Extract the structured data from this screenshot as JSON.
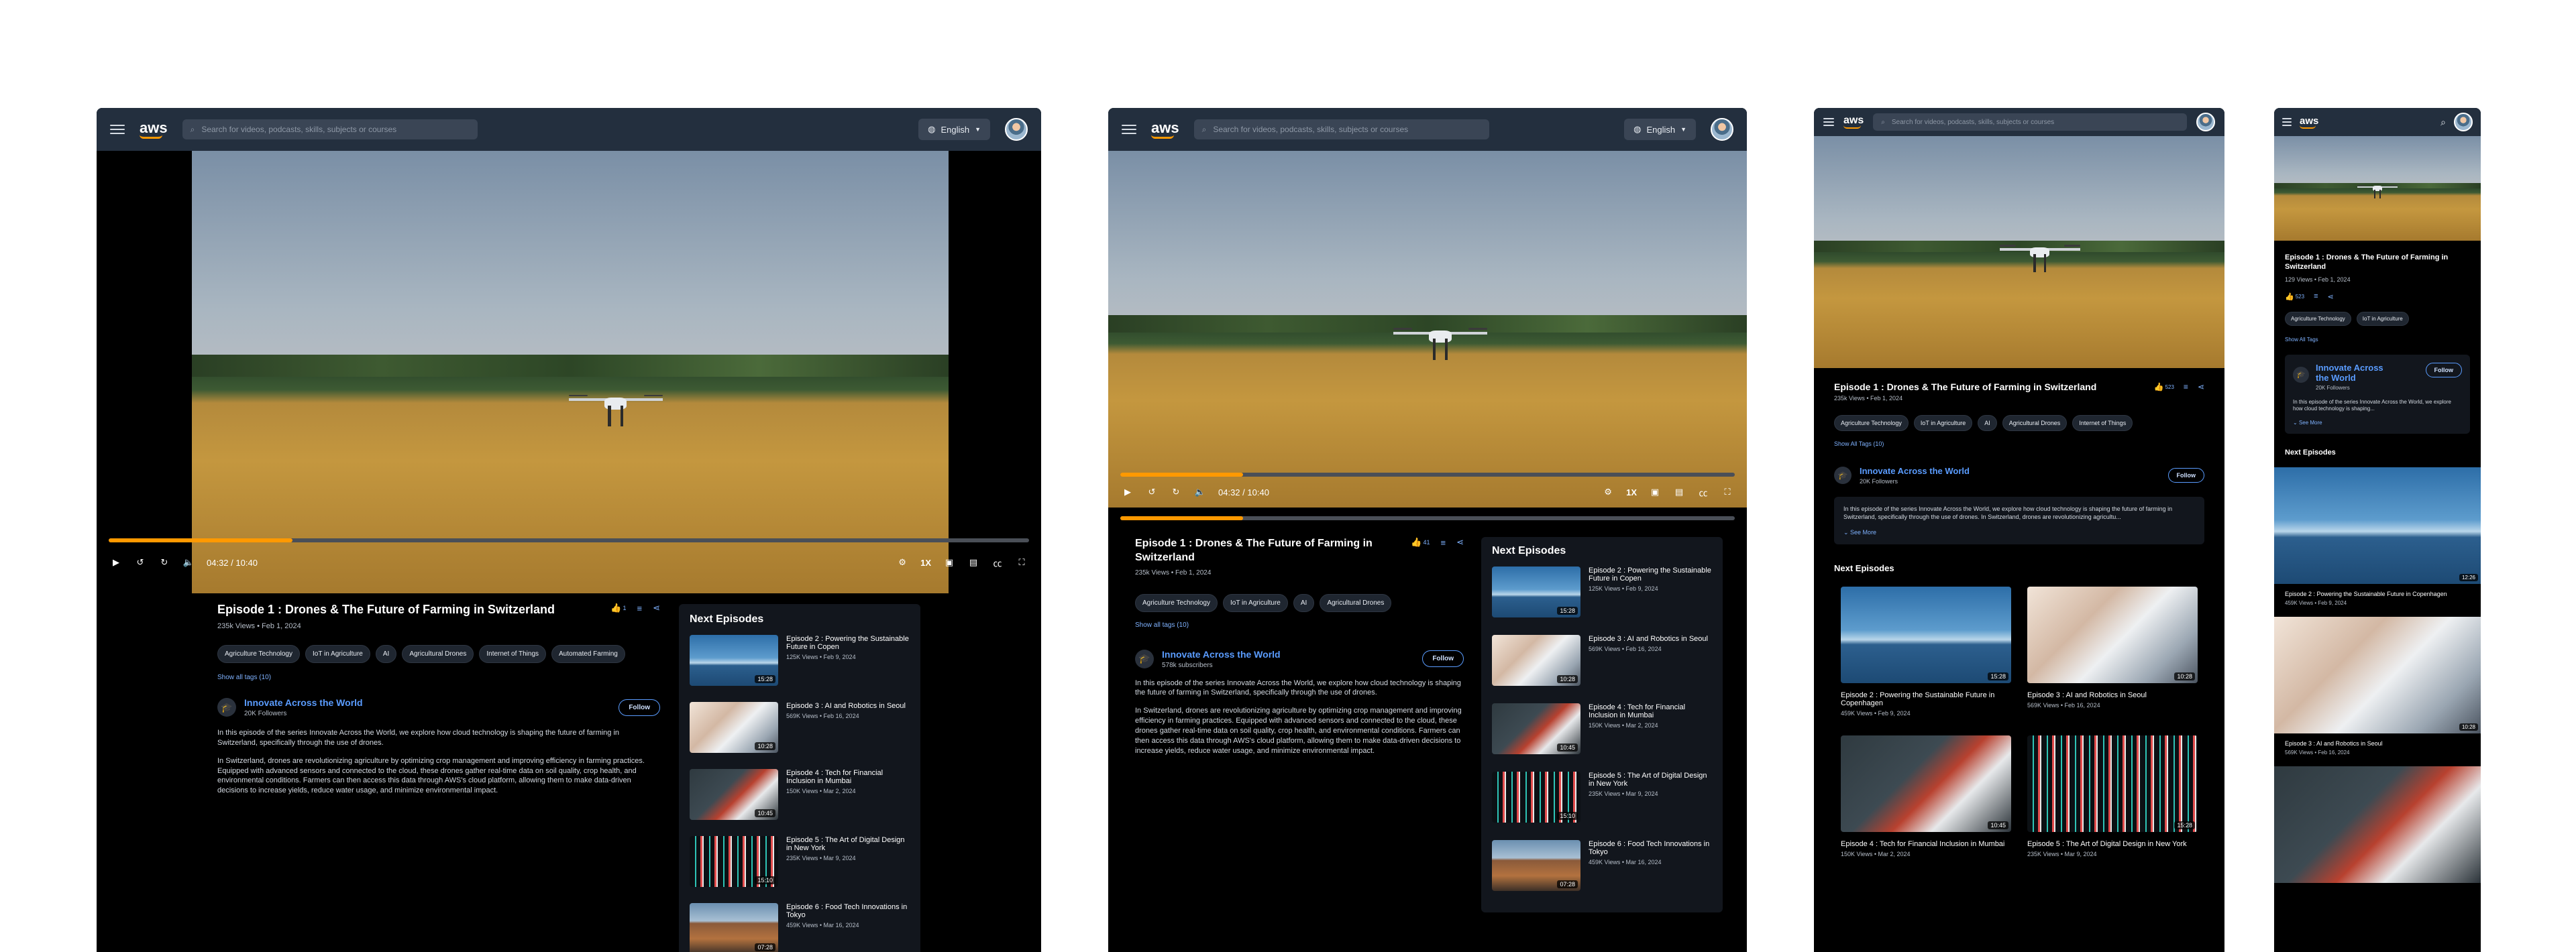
{
  "app": {
    "search_placeholder": "Search for videos, podcasts, skills, subjects or courses",
    "language": "English",
    "logo_text": "aws"
  },
  "video": {
    "time_current": "04:32",
    "time_total": "10:40",
    "time_sep": " / ",
    "speed": "1X",
    "progress": 0.2
  },
  "episode": {
    "title": "Episode 1 : Drones & The Future of Farming in Switzerland",
    "views_a": "235k Views",
    "views_c": "235k Views",
    "views_d": "129 Views",
    "date": "Feb 1, 2024",
    "likes_a": "1",
    "likes_b": "41",
    "likes_c": "523",
    "likes_d": "523"
  },
  "tags": {
    "list": [
      "Agriculture Technology",
      "IoT in Agriculture",
      "AI",
      "Agricultural Drones",
      "Internet of Things",
      "Automated Farming"
    ],
    "show_all_a": "Show all tags (10)",
    "show_all_c": "Show All Tags (10)",
    "show_all_d": "Show All Tags"
  },
  "channel": {
    "name": "Innovate Across the World",
    "name_line1": "Innovate Across",
    "name_line2": "the World",
    "followers_a": "20K Followers",
    "followers_b": "578k subscribers",
    "follow_label": "Follow",
    "desc_p1": "In this episode of the series Innovate Across the World, we explore how cloud technology is shaping the future of farming in Switzerland, specifically through the use of drones.",
    "desc_p2": "In Switzerland, drones are revolutionizing agriculture by optimizing crop management and improving efficiency in farming practices. Equipped with advanced sensors and connected to the cloud, these drones gather real-time data on soil quality, crop health, and environmental conditions. Farmers can then access this data through AWS's cloud platform, allowing them to make data-driven decisions to increase yields, reduce water usage, and minimize environmental impact.",
    "desc_short": "In this episode of the series Innovate Across the World, we explore how cloud technology is shaping the future of farming in Switzerland, specifically through the use of drones. In Switzerland, drones are revolutionizing agricultu...",
    "desc_short_d": "In this episode of the series Innovate Across the World, we explore how cloud technology is shaping...",
    "see_more": "See More"
  },
  "next": {
    "heading": "Next Episodes",
    "episodes": [
      {
        "title": "Episode 2 : Powering the Sustainable Future in Copen",
        "title_full": "Episode 2 : Powering the Sustainable Future in Copenhagen",
        "views": "125K Views",
        "views_c": "459K Views",
        "views_d": "459K Views",
        "date": "Feb 9, 2024",
        "duration": "15:28",
        "duration_d": "12:26"
      },
      {
        "title": "Episode 3 : AI and Robotics in Seoul",
        "title_full": "Episode 3 : AI and Robotics in Seoul",
        "views": "569K Views",
        "views_c": "569K Views",
        "views_d": "569K Views",
        "date": "Feb 16, 2024",
        "duration": "10:28",
        "duration_d": "10:28"
      },
      {
        "title": "Episode 4 : Tech for Financial Inclusion in Mumbai",
        "title_full": "Episode 4 : Tech for Financial Inclusion in Mumbai",
        "views": "150K Views",
        "views_c": "150K Views",
        "date": "Mar 2, 2024",
        "duration": "10:45"
      },
      {
        "title": "Episode 5 : The Art of Digital Design in New York",
        "title_full": "Episode 5 : The Art of Digital Design in New York",
        "views": "235K Views",
        "views_c": "235K Views",
        "date": "Mar 9, 2024",
        "duration": "15:10",
        "duration_c": "15:28"
      },
      {
        "title": "Episode 6 : Food Tech Innovations in Tokyo",
        "title_full": "Episode 6 : Food Tech Innovations in Tokyo",
        "views": "459K Views",
        "date": "Mar 16, 2024",
        "duration": "07:28"
      }
    ]
  },
  "colors": {
    "accent": "#ff9900",
    "topbar": "#232f3e",
    "link": "#5a9cff"
  }
}
